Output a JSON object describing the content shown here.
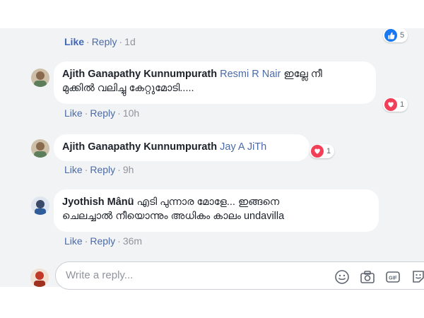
{
  "comments": [
    {
      "actions": {
        "like": "Like",
        "reply": "Reply",
        "time": "1d"
      },
      "reaction_count": "5",
      "reaction_icon": "like-icon"
    },
    {
      "author": "Ajith Ganapathy Kunnumpurath",
      "mention": "Resmi R Nair",
      "text_line1": "ഇല്ലേ നീ",
      "text_line2": "മുക്കിൽ വലിച്ചു കേറ്റുമോടി.....",
      "actions": {
        "like": "Like",
        "reply": "Reply",
        "time": "10h"
      },
      "reaction_count": "1",
      "reaction_icon": "heart-icon"
    },
    {
      "author": "Ajith Ganapathy Kunnumpurath",
      "mention": "Jay A JiTh",
      "actions": {
        "like": "Like",
        "reply": "Reply",
        "time": "9h"
      },
      "reaction_count": "1",
      "reaction_icon": "heart-icon"
    },
    {
      "author": "Jyothish Mânü",
      "text_line1": "എടി പുന്നാര മോളേ... ഇങ്ങനെ",
      "text_line2": "ചെലച്ചാൽ നീയൊന്നും അധികം കാലം undavilla",
      "actions": {
        "like": "Like",
        "reply": "Reply",
        "time": "36m"
      }
    }
  ],
  "reply_box": {
    "placeholder": "Write a reply...",
    "tools": [
      "emoji-icon",
      "camera-icon",
      "gif-icon",
      "sticker-icon"
    ]
  },
  "colors": {
    "link": "#4b6aa8",
    "like": "#4267b2",
    "heart": "#f33e58",
    "thumb": "#1877f2",
    "panel": "#f2f3f5"
  }
}
